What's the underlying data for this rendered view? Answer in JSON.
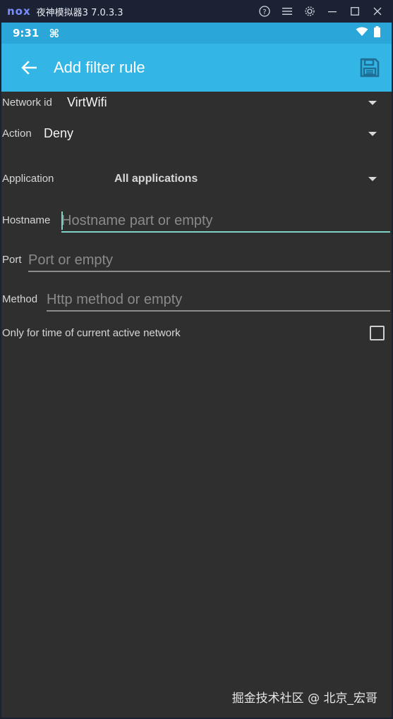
{
  "emulator": {
    "logo": "nox",
    "title": "夜神模拟器3 7.0.3.3",
    "controls": [
      "help-icon",
      "menu-icon",
      "settings-icon",
      "minimize-icon",
      "maximize-icon",
      "close-icon"
    ]
  },
  "status_bar": {
    "time": "9:31",
    "cmd_symbol": "⌘"
  },
  "app_bar": {
    "title": "Add filter rule"
  },
  "form": {
    "network_id_label": "Network id",
    "network_id_value": "VirtWifi",
    "action_label": "Action",
    "action_value": "Deny",
    "application_label": "Application",
    "application_value": "All applications",
    "hostname_label": "Hostname",
    "hostname_placeholder": "Hostname part or empty",
    "port_label": "Port",
    "port_placeholder": "Port or empty",
    "method_label": "Method",
    "method_placeholder": "Http method or empty",
    "only_current_label": "Only for time of current active network",
    "only_current_checked": false
  },
  "watermark": "掘金技术社区 @ 北京_宏哥",
  "colors": {
    "app_bar": "#33b5e5",
    "status_bar": "#2aa6d9",
    "background": "#2f2f2f",
    "accent": "#7fd3c4"
  }
}
